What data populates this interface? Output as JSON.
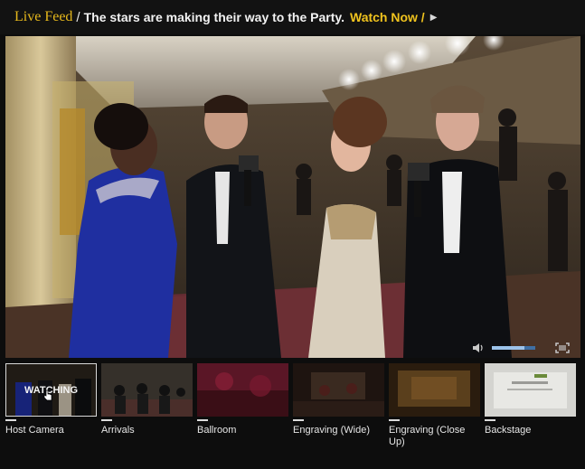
{
  "header": {
    "live_label": "Live Feed",
    "separator": "/",
    "headline": "The stars are making their way to the Party.",
    "watch_link": "Watch Now /",
    "watch_icon": "play-arrow-icon",
    "accent_color": "#e6b81c"
  },
  "player": {
    "volume_icon": "speaker-icon",
    "volume_level": 0.75,
    "fullscreen_icon": "fullscreen-icon"
  },
  "cameras": [
    {
      "label": "Host Camera",
      "status": "WATCHING"
    },
    {
      "label": "Arrivals"
    },
    {
      "label": "Ballroom"
    },
    {
      "label": "Engraving (Wide)"
    },
    {
      "label": "Engraving (Close Up)"
    },
    {
      "label": "Backstage"
    }
  ]
}
